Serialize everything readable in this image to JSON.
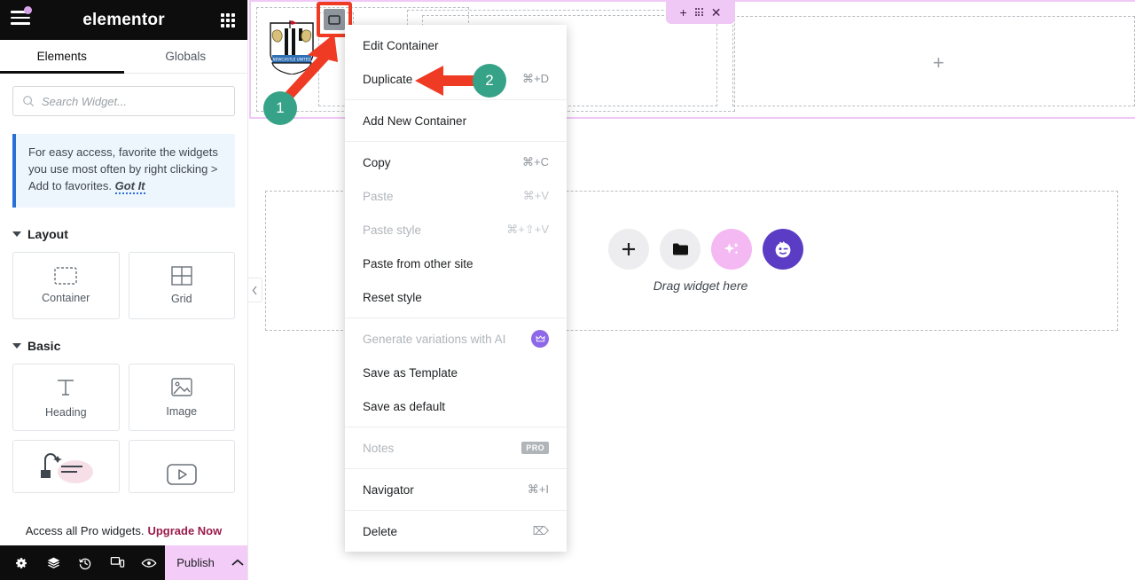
{
  "panel": {
    "brand": "elementor",
    "menu_icon": "hamburger-icon",
    "apps_icon": "apps-grid-icon",
    "tabs": [
      {
        "label": "Elements",
        "active": true
      },
      {
        "label": "Globals",
        "active": false
      }
    ],
    "search": {
      "placeholder": "Search Widget...",
      "value": "",
      "icon": "search-icon"
    },
    "notice": {
      "text": "For easy access, favorite the widgets you use most often by right clicking > Add to favorites.",
      "action": "Got It",
      "accent": "#2a6fd6",
      "background": "#eef6fd"
    },
    "sections": [
      {
        "title": "Layout",
        "widgets": [
          {
            "label": "Container",
            "icon": "container-icon"
          },
          {
            "label": "Grid",
            "icon": "grid-icon"
          }
        ]
      },
      {
        "title": "Basic",
        "widgets": [
          {
            "label": "Heading",
            "icon": "heading-icon"
          },
          {
            "label": "Image",
            "icon": "image-icon"
          }
        ]
      }
    ],
    "pro_bar": {
      "text": "Access all Pro widgets.",
      "link": "Upgrade Now",
      "link_color": "#9b1c4b"
    },
    "bottom_bar": {
      "icons": [
        "settings-gear-icon",
        "layers-icon",
        "history-icon",
        "responsive-mode-icon",
        "preview-eye-icon"
      ],
      "publish_label": "Publish",
      "publish_color": "#f3ccf8",
      "publish_caret": "chevron-up-icon"
    },
    "collapse_icon": "chevron-left-icon"
  },
  "canvas": {
    "logo": "newcastle-united-crest",
    "container_handle_icon": "container-handle-icon",
    "highlight_color": "#ef3b23",
    "section_toolbar": {
      "add": "+",
      "drag": "drag-dots-icon",
      "close": "✕",
      "color": "#f0c8f5"
    },
    "empty_slot_plus": "+",
    "widget_buttons": [
      {
        "icon": "plus-icon",
        "color": "#ededef"
      },
      {
        "icon": "folder-icon",
        "color": "#ededef"
      },
      {
        "icon": "ai-sparkles-icon",
        "color": "#f4b8f2"
      },
      {
        "icon": "wink-face-icon",
        "color": "#5b3cc4"
      }
    ],
    "drag_label": "Drag widget here"
  },
  "context_menu": {
    "items": [
      {
        "label": "Edit Container",
        "shortcut": "",
        "disabled": false,
        "badge": ""
      },
      {
        "label": "Duplicate",
        "shortcut": "⌘+D",
        "disabled": false,
        "badge": ""
      },
      {
        "separator": true
      },
      {
        "label": "Add New Container",
        "shortcut": "",
        "disabled": false,
        "badge": ""
      },
      {
        "separator": true
      },
      {
        "label": "Copy",
        "shortcut": "⌘+C",
        "disabled": false,
        "badge": ""
      },
      {
        "label": "Paste",
        "shortcut": "⌘+V",
        "disabled": true,
        "badge": ""
      },
      {
        "label": "Paste style",
        "shortcut": "⌘+⇧+V",
        "disabled": true,
        "badge": ""
      },
      {
        "label": "Paste from other site",
        "shortcut": "",
        "disabled": false,
        "badge": ""
      },
      {
        "label": "Reset style",
        "shortcut": "",
        "disabled": false,
        "badge": ""
      },
      {
        "separator": true
      },
      {
        "label": "Generate variations with AI",
        "shortcut": "",
        "disabled": true,
        "badge": "ai"
      },
      {
        "label": "Save as Template",
        "shortcut": "",
        "disabled": false,
        "badge": ""
      },
      {
        "label": "Save as default",
        "shortcut": "",
        "disabled": false,
        "badge": ""
      },
      {
        "separator": true
      },
      {
        "label": "Notes",
        "shortcut": "",
        "disabled": true,
        "badge": "PRO"
      },
      {
        "separator": true
      },
      {
        "label": "Navigator",
        "shortcut": "⌘+I",
        "disabled": false,
        "badge": ""
      },
      {
        "separator": true
      },
      {
        "label": "Delete",
        "shortcut": "⌦",
        "disabled": false,
        "badge": ""
      }
    ]
  },
  "annotations": {
    "badge_color": "#36a287",
    "arrow_color": "#ef3b23",
    "steps": [
      {
        "number": "1",
        "target": "container-handle"
      },
      {
        "number": "2",
        "target": "duplicate-menu-item"
      }
    ]
  }
}
